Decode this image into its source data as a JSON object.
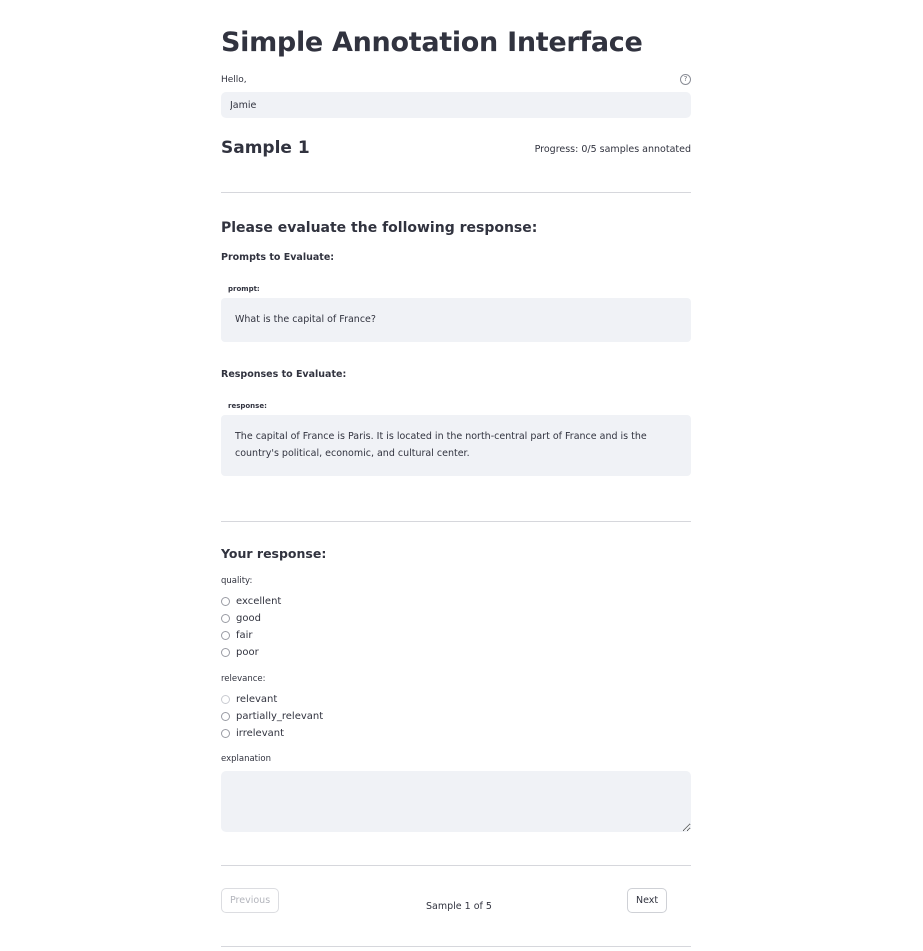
{
  "header": {
    "title": "Simple Annotation Interface"
  },
  "user": {
    "greeting_label": "Hello,",
    "help_icon": "?",
    "name_value": "Jamie"
  },
  "sample": {
    "heading": "Sample 1",
    "progress": "Progress: 0/5 samples annotated"
  },
  "evaluation": {
    "heading": "Please evaluate the following response:",
    "prompts_title": "Prompts to Evaluate:",
    "prompt_label": "prompt:",
    "prompt_text": "What is the capital of France?",
    "responses_title": "Responses to Evaluate:",
    "response_label": "response:",
    "response_text": "The capital of France is Paris. It is located in the north-central part of France and is the country's political, economic, and cultural center."
  },
  "form": {
    "heading": "Your response:",
    "quality": {
      "label": "quality:",
      "options": [
        "excellent",
        "good",
        "fair",
        "poor"
      ]
    },
    "relevance": {
      "label": "relevance:",
      "options": [
        "relevant",
        "partially_relevant",
        "irrelevant"
      ]
    },
    "explanation": {
      "label": "explanation",
      "value": ""
    }
  },
  "navigation": {
    "previous_label": "Previous",
    "next_label": "Next",
    "sample_count": "Sample 1 of 5"
  }
}
